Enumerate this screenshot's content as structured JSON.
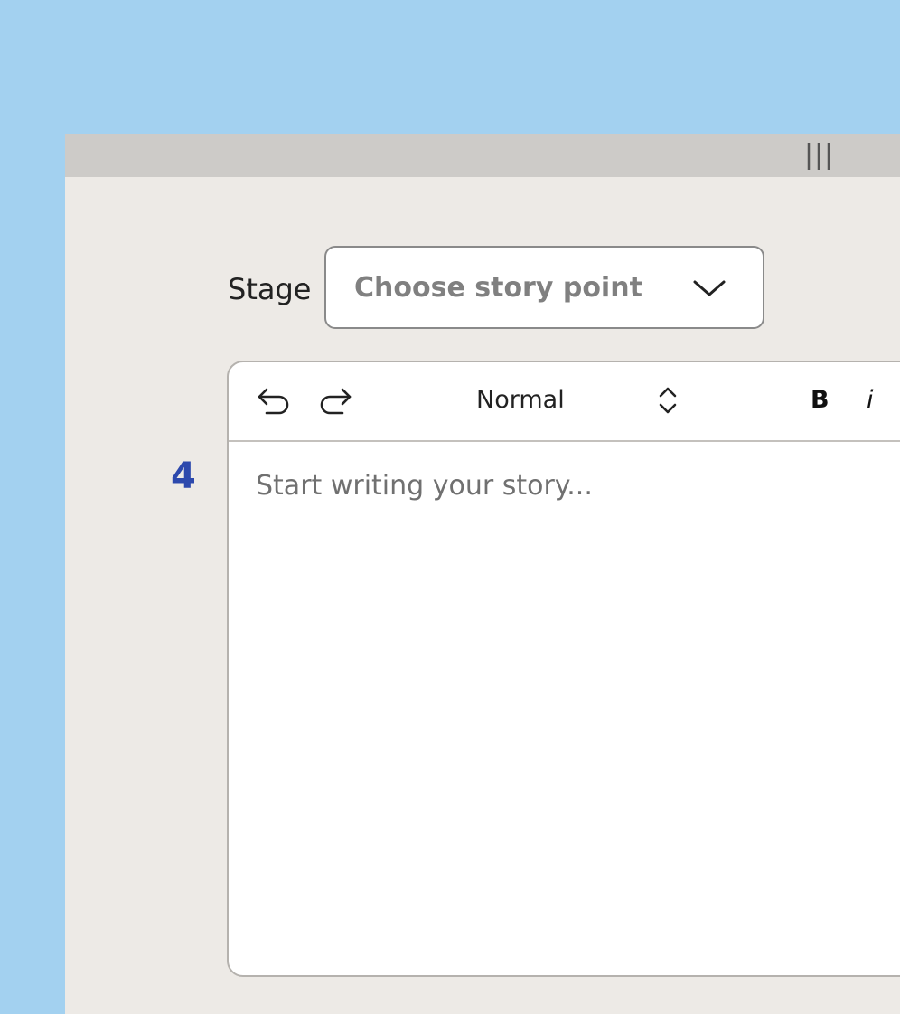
{
  "stage": {
    "label": "Stage",
    "select_placeholder": "Choose story point"
  },
  "step_number": "4",
  "editor": {
    "toolbar": {
      "format_value": "Normal",
      "bold_label": "B",
      "italic_label": "i"
    },
    "placeholder": "Start writing your story..."
  },
  "colors": {
    "background": "#a3d1f0",
    "window": "#edeae6",
    "titlebar": "#cdcbc8",
    "step_number": "#2d49ad"
  },
  "icons": {
    "grip": "grip-lines-icon",
    "select_chevron": "chevron-down-icon",
    "undo": "undo-icon",
    "redo": "redo-icon",
    "format_stepper": "up-down-chevron-icon"
  }
}
